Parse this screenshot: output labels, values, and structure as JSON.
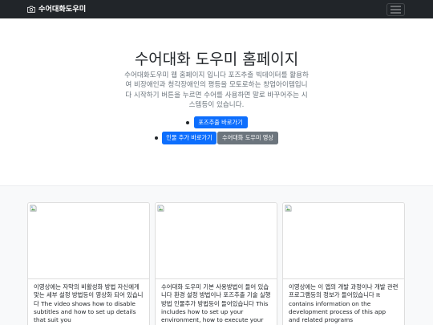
{
  "navbar": {
    "brand": "수어대화도우미",
    "brand_icon": "camera-icon",
    "toggler_icon": "hamburger-menu-icon"
  },
  "hero": {
    "title": "수어대화 도우미 홈페이지",
    "lead": "수어대화도우미 웹 홈페이지 입니다 포즈추출 빅데이터를 활용하여 비장애인과 청각장애인의 평등을 모토로하는 창업아이템입니다 시작하기 버튼을 누르면 수어를 사용하면 말로 바꾸어주는 시스템등이 있습니다.",
    "buttons": {
      "pose_extraction": "포즈추출 바로가기",
      "add_person": "인물 추가 바로가기",
      "video": "수어대화 도우미 영상"
    }
  },
  "cards": [
    {
      "image_icon": "broken-image-icon",
      "text": "이영상에는 자막의 비활성화 방법 자신에게 맞는 세부 설정 방법등이 영상화 되어 있습니다 The video shows how to disable subtitles and how to set up details that suit you"
    },
    {
      "image_icon": "broken-image-icon",
      "text": "수어대화 도우미 기본 사용방법이 들어 있습니다 환경 설정 방법이나 포즈추출 기술 실행 방법 인물추가 방법등이 들어있습니다 This includes how to set up your environment, how to execute your"
    },
    {
      "image_icon": "broken-image-icon",
      "text": "이영상에는 이 앱의 개발 과정이나 개발 관련 프로그램등의 정보가 들어있습니다 It contains information on the development process of this app and related programs"
    }
  ],
  "colors": {
    "navbar_bg": "#212529",
    "primary": "#0d6efd",
    "secondary": "#6c757d",
    "album_bg": "#f8f9fa",
    "muted_text": "#6c757d"
  }
}
